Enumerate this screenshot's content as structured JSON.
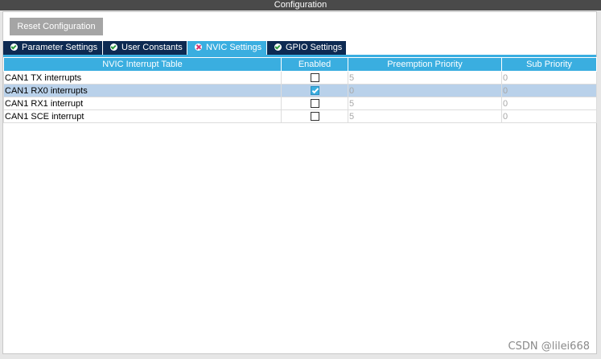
{
  "window": {
    "title": "Configuration"
  },
  "toolbar": {
    "reset_label": "Reset Configuration"
  },
  "tabs": [
    {
      "label": "Parameter Settings",
      "icon": "check-circle-icon",
      "active": false
    },
    {
      "label": "User Constants",
      "icon": "check-circle-icon",
      "active": false
    },
    {
      "label": "NVIC Settings",
      "icon": "x-circle-icon",
      "active": true
    },
    {
      "label": "GPIO Settings",
      "icon": "check-circle-icon",
      "active": false
    }
  ],
  "table": {
    "headers": [
      "NVIC Interrupt Table",
      "Enabled",
      "Preemption Priority",
      "Sub Priority"
    ],
    "rows": [
      {
        "name": "CAN1 TX interrupts",
        "enabled": false,
        "preemption": "5",
        "sub": "0",
        "selected": false
      },
      {
        "name": "CAN1 RX0 interrupts",
        "enabled": true,
        "preemption": "0",
        "sub": "0",
        "selected": true
      },
      {
        "name": "CAN1 RX1 interrupt",
        "enabled": false,
        "preemption": "5",
        "sub": "0",
        "selected": false
      },
      {
        "name": "CAN1 SCE interrupt",
        "enabled": false,
        "preemption": "5",
        "sub": "0",
        "selected": false
      }
    ]
  },
  "watermark": "CSDN @lilei668",
  "colors": {
    "tab_active": "#3aaee0",
    "tab_inactive": "#0d2a52",
    "header": "#3aaee0",
    "row_selected": "#b9d1ea"
  }
}
